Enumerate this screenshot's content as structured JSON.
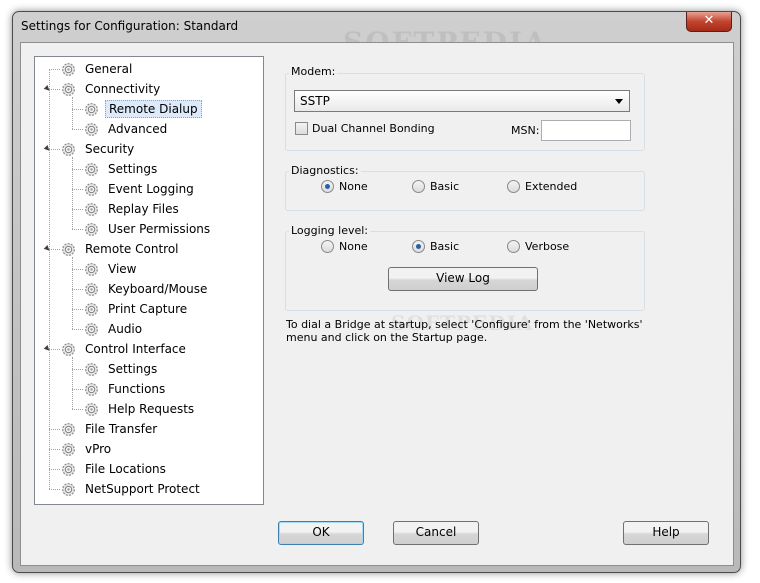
{
  "window": {
    "title": "Settings for Configuration: Standard",
    "close_glyph": "✕"
  },
  "watermark": "SOFTPEDIA",
  "tree": [
    {
      "label": "General",
      "level": 0,
      "expander": ""
    },
    {
      "label": "Connectivity",
      "level": 0,
      "expander": "▲"
    },
    {
      "label": "Remote Dialup",
      "level": 1,
      "selected": true
    },
    {
      "label": "Advanced",
      "level": 1
    },
    {
      "label": "Security",
      "level": 0,
      "expander": "▲"
    },
    {
      "label": "Settings",
      "level": 1
    },
    {
      "label": "Event Logging",
      "level": 1
    },
    {
      "label": "Replay Files",
      "level": 1
    },
    {
      "label": "User Permissions",
      "level": 1
    },
    {
      "label": "Remote Control",
      "level": 0,
      "expander": "▲"
    },
    {
      "label": "View",
      "level": 1
    },
    {
      "label": "Keyboard/Mouse",
      "level": 1
    },
    {
      "label": "Print Capture",
      "level": 1
    },
    {
      "label": "Audio",
      "level": 1
    },
    {
      "label": "Control Interface",
      "level": 0,
      "expander": "▲"
    },
    {
      "label": "Settings",
      "level": 1
    },
    {
      "label": "Functions",
      "level": 1
    },
    {
      "label": "Help Requests",
      "level": 1
    },
    {
      "label": "File Transfer",
      "level": 0
    },
    {
      "label": "vPro",
      "level": 0
    },
    {
      "label": "File Locations",
      "level": 0
    },
    {
      "label": "NetSupport Protect",
      "level": 0
    }
  ],
  "modem": {
    "label": "Modem:",
    "selected": "SSTP",
    "dual_channel_label": "Dual Channel Bonding",
    "dual_channel_checked": false,
    "msn_label": "MSN:",
    "msn_value": ""
  },
  "diagnostics": {
    "label": "Diagnostics:",
    "options": [
      "None",
      "Basic",
      "Extended"
    ],
    "selected": "None"
  },
  "logging": {
    "label": "Logging level:",
    "options": [
      "None",
      "Basic",
      "Verbose"
    ],
    "selected": "Basic",
    "view_log_label": "View Log"
  },
  "info_text": "To dial a Bridge at startup, select 'Configure' from the 'Networks' menu and click on the Startup page.",
  "buttons": {
    "ok": "OK",
    "cancel": "Cancel",
    "help": "Help"
  }
}
